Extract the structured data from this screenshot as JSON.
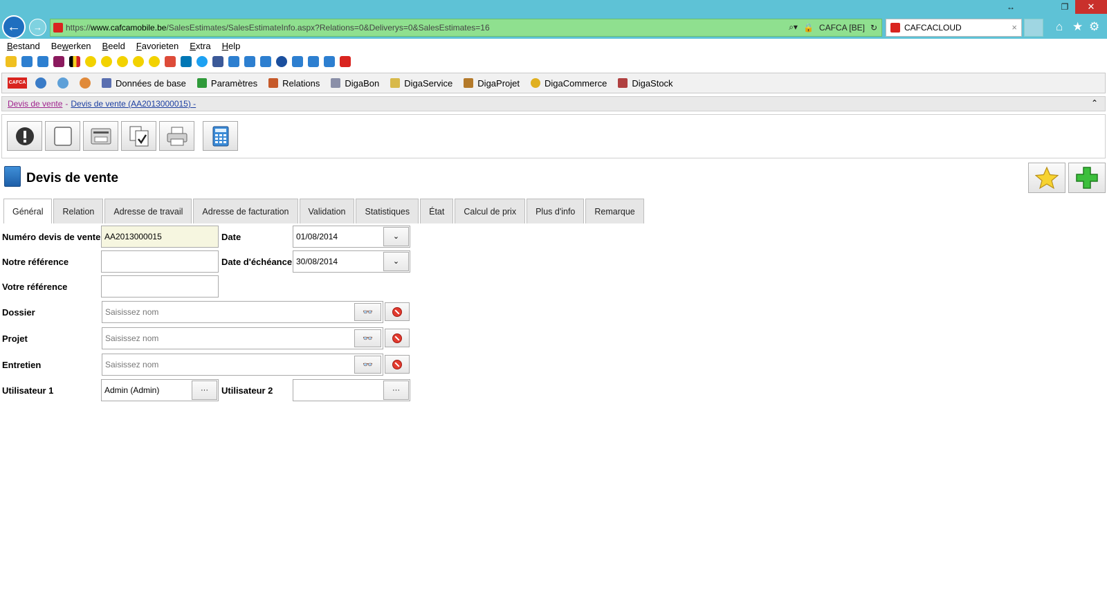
{
  "window": {
    "min_icon": "resize-arrows-icon",
    "restore_label": "❐",
    "close_label": "✕"
  },
  "browser": {
    "url_scheme": "https://",
    "url_host": "www.cafcamobile.be",
    "url_path": "/SalesEstimates/SalesEstimateInfo.aspx?Relations=0&Deliverys=0&SalesEstimates=16",
    "cert_name": "CAFCA [BE]",
    "tab_title": "CAFCACLOUD",
    "tab_close": "×"
  },
  "menubar": {
    "items": [
      {
        "label_pre": "",
        "key": "B",
        "label_post": "estand"
      },
      {
        "label_pre": "Be",
        "key": "w",
        "label_post": "erken"
      },
      {
        "label_pre": "",
        "key": "B",
        "label_post": "eeld"
      },
      {
        "label_pre": "",
        "key": "F",
        "label_post": "avorieten"
      },
      {
        "label_pre": "",
        "key": "E",
        "label_post": "xtra"
      },
      {
        "label_pre": "",
        "key": "H",
        "label_post": "elp"
      }
    ]
  },
  "app_menu": {
    "logo_text": "CAFCA",
    "items": [
      {
        "label": "Données de base",
        "color": "#5a6fb0"
      },
      {
        "label": "Paramètres",
        "color": "#2f9a3a"
      },
      {
        "label": "Relations",
        "color": "#c65a2a"
      },
      {
        "label": "DigaBon",
        "color": "#8a8fa8"
      },
      {
        "label": "DigaService",
        "color": "#d8b94a"
      },
      {
        "label": "DigaProjet",
        "color": "#b47a2a"
      },
      {
        "label": "DigaCommerce",
        "color": "#e0b020"
      },
      {
        "label": "DigaStock",
        "color": "#b04040"
      }
    ]
  },
  "breadcrumb": {
    "first": "Devis de vente",
    "sep": "-",
    "second": "Devis de vente (AA2013000015) -",
    "collapse": "⌃"
  },
  "page": {
    "title": "Devis de vente"
  },
  "tabs": [
    {
      "label": "Général",
      "active": true
    },
    {
      "label": "Relation"
    },
    {
      "label": "Adresse de travail"
    },
    {
      "label": "Adresse de facturation"
    },
    {
      "label": "Validation"
    },
    {
      "label": "Statistiques"
    },
    {
      "label": "État"
    },
    {
      "label": "Calcul de prix"
    },
    {
      "label": "Plus d'info"
    },
    {
      "label": "Remarque"
    }
  ],
  "form": {
    "numero_label": "Numéro devis de vente",
    "numero_value": "AA2013000015",
    "date_label": "Date",
    "date_value": "01/08/2014",
    "notre_ref_label": "Notre référence",
    "notre_ref_value": "",
    "echeance_label": "Date d'échéance",
    "echeance_value": "30/08/2014",
    "votre_ref_label": "Votre référence",
    "votre_ref_value": "",
    "dossier_label": "Dossier",
    "projet_label": "Projet",
    "entretien_label": "Entretien",
    "lookup_placeholder": "Saisissez nom",
    "user1_label": "Utilisateur 1",
    "user1_value": "Admin (Admin)",
    "user2_label": "Utilisateur 2",
    "user2_value": "",
    "ellipsis": "···",
    "dropdown_glyph": "⌄"
  },
  "colors": {
    "chrome": "#5ec2d6",
    "address_bar": "#8fe08f",
    "close_button": "#c9302c",
    "breadcrumb_link": "#a0248e",
    "breadcrumb_link2": "#1b3ea1",
    "readonly_field": "#f6f6e0"
  }
}
